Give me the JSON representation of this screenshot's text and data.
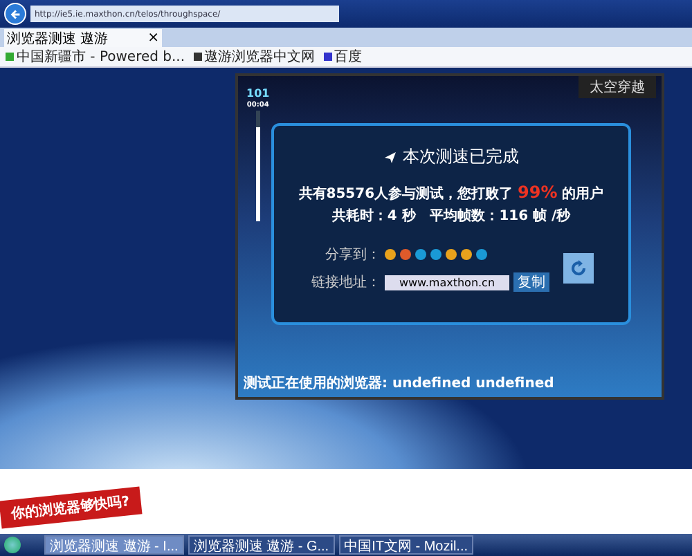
{
  "browser": {
    "url": "http://ie5.ie.maxthon.cn/telos/throughspace/",
    "tab": {
      "title": "浏览器测速 遨游",
      "close": "×"
    },
    "favorites": [
      {
        "label": "中国新疆市 - Powered b..."
      },
      {
        "label": "遨游浏览器中文网"
      },
      {
        "label": "百度"
      }
    ]
  },
  "game": {
    "badge": "太空穿越",
    "meter": {
      "score": "101",
      "time": "00:04",
      "level": 0.85
    },
    "result": {
      "title": "本次测速已完成",
      "summary": "共有85576人参与测试，您打败了 **99%** 的用户",
      "stats": "共耗时：4 秒   平均帧数：116 帧 /秒",
      "share_label": "分享到：",
      "share_icons": [
        {
          "color": "#e8a21c"
        },
        {
          "color": "#e05a2a"
        },
        {
          "color": "#1a9ad6"
        },
        {
          "color": "#1a9ad6"
        },
        {
          "color": "#e8a21c"
        },
        {
          "color": "#e8a21c"
        },
        {
          "color": "#1a9ad6"
        }
      ],
      "link_label": "链接地址：",
      "link_value": "www.maxthon.cn",
      "copy_button": "复制"
    },
    "footer": "测试正在使用的浏览器: undefined undefined"
  },
  "slogan": "你的浏览器够快吗?",
  "taskbar": [
    {
      "label": "浏览器测速 遨游 - I...",
      "selected": true
    },
    {
      "label": "浏览器测速 遨游 - G...",
      "selected": false
    },
    {
      "label": "中国IT文网 - Mozil...",
      "selected": false
    }
  ]
}
